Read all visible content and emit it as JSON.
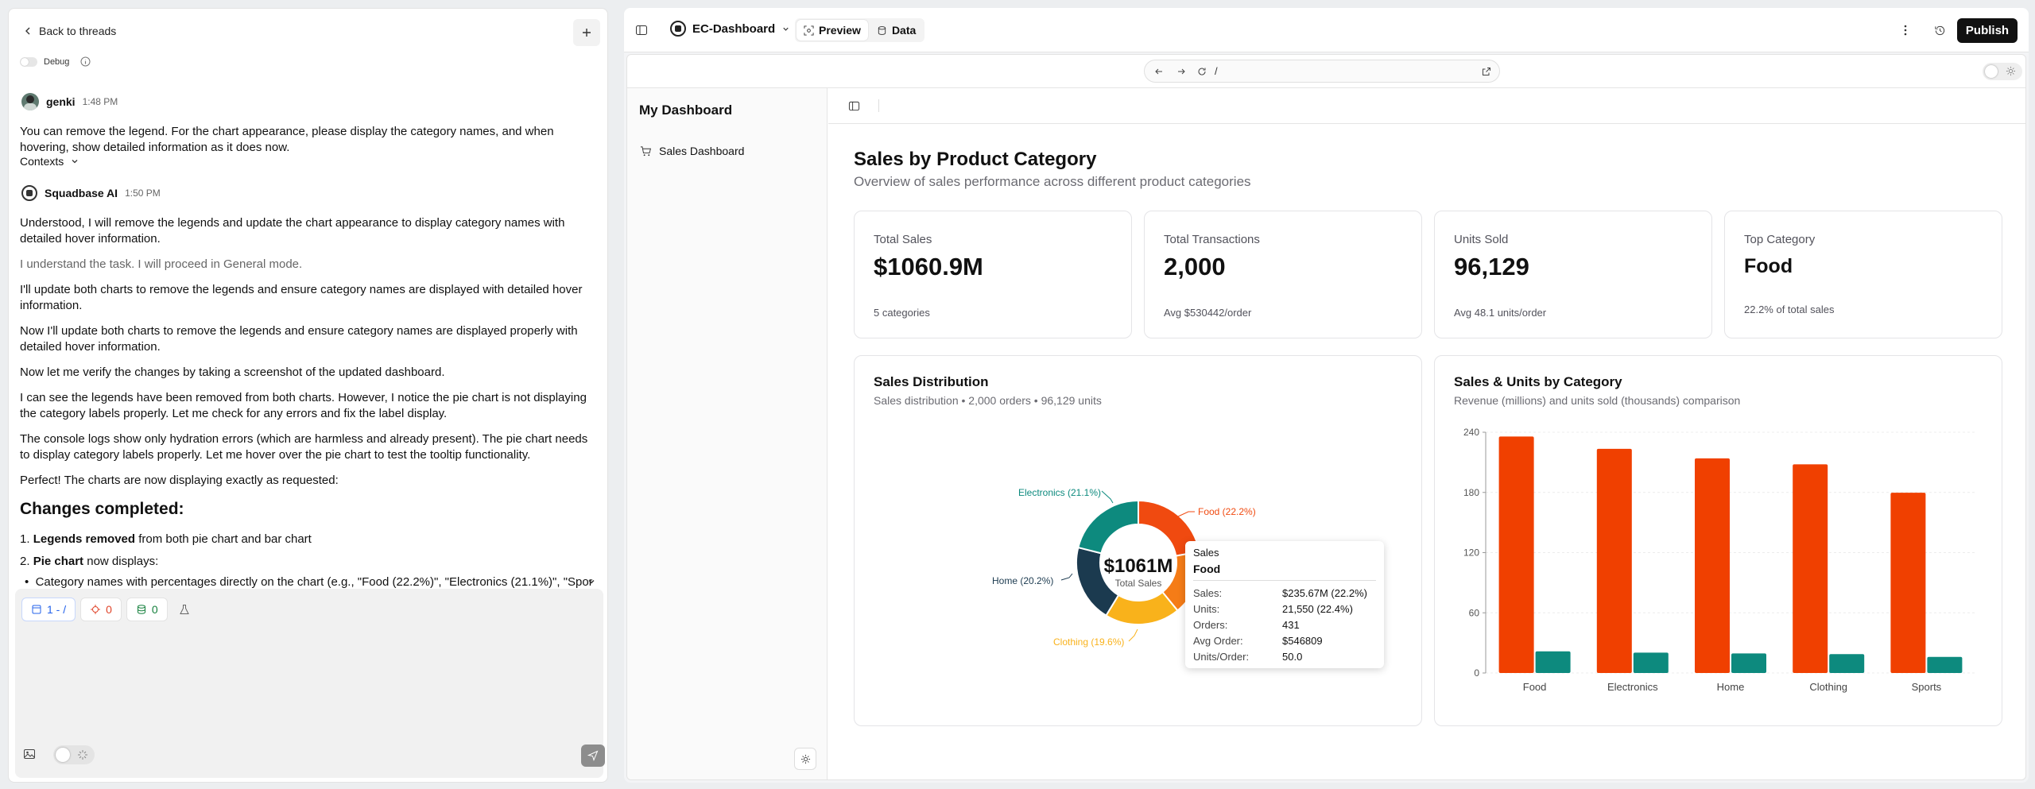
{
  "thread": {
    "back_label": "Back to threads",
    "debug_label": "Debug",
    "user_name": "genki",
    "user_time": "1:48 PM",
    "user_message": "You can remove the legend. For the chart appearance, please display the category names, and when hovering, show detailed information as it does now.",
    "contexts_label": "Contexts",
    "ai_name": "Squadbase AI",
    "ai_time": "1:50 PM",
    "ai_p1": "Understood, I will remove the legends and update the chart appearance to display category names with detailed hover information.",
    "ai_p2": "I understand the task. I will proceed in General mode.",
    "ai_p3": "I'll update both charts to remove the legends and ensure category names are displayed with detailed hover information.",
    "ai_p4": "Now I'll update both charts to remove the legends and ensure category names are displayed properly with detailed hover information.",
    "ai_p5": "Now let me verify the changes by taking a screenshot of the updated dashboard.",
    "ai_p6": "I can see the legends have been removed from both charts. However, I notice the pie chart is not displaying the category labels properly. Let me check for any errors and fix the label display.",
    "ai_p7": "The console logs show only hydration errors (which are harmless and already present). The pie chart needs to display category labels properly. Let me hover over the pie chart to test the tooltip functionality.",
    "ai_p8": "Perfect! The charts are now displaying exactly as requested:",
    "changes_heading": "Changes completed:",
    "li1_bold": "Legends removed",
    "li1_rest": " from both pie chart and bar chart",
    "li2_bold": "Pie chart",
    "li2_rest": " now displays:",
    "bullet1": "Category names with percentages directly on the chart (e.g., \"Food (22.2%)\", \"Electronics (21.1%)\", \"Sport..."
  },
  "composer": {
    "page_chip": "1 - /",
    "errors_count": "0",
    "data_count": "0"
  },
  "topbar": {
    "app_name": "EC-Dashboard",
    "preview_tab": "Preview",
    "data_tab": "Data",
    "publish_label": "Publish",
    "url_path": "/"
  },
  "sidebar": {
    "title": "My Dashboard",
    "item_sales": "Sales Dashboard"
  },
  "page": {
    "title": "Sales by Product Category",
    "subtitle": "Overview of sales performance across different product categories"
  },
  "kpis": [
    {
      "label": "Total Sales",
      "value": "$1060.9M",
      "sub": "5 categories"
    },
    {
      "label": "Total Transactions",
      "value": "2,000",
      "sub": "Avg $530442/order"
    },
    {
      "label": "Units Sold",
      "value": "96,129",
      "sub": "Avg 48.1 units/order"
    },
    {
      "label": "Top Category",
      "value": "Food",
      "sub": "22.2% of total sales"
    }
  ],
  "donut": {
    "title": "Sales Distribution",
    "subtitle": "Sales distribution • 2,000 orders • 96,129 units",
    "center_value": "$1061M",
    "center_label": "Total Sales",
    "label_electronics": "Electronics (21.1%)",
    "label_food": "Food (22.2%)",
    "label_home": "Home (20.2%)",
    "label_clothing": "Clothing (19.6%)"
  },
  "tooltip": {
    "series": "Sales",
    "category": "Food",
    "rows": [
      {
        "k": "Sales:",
        "v": "$235.67M (22.2%)"
      },
      {
        "k": "Units:",
        "v": "21,550 (22.4%)"
      },
      {
        "k": "Orders:",
        "v": "431"
      },
      {
        "k": "Avg Order:",
        "v": "$546809"
      },
      {
        "k": "Units/Order:",
        "v": "50.0"
      }
    ]
  },
  "bar": {
    "title": "Sales & Units by Category",
    "subtitle": "Revenue (millions) and units sold (thousands) comparison"
  },
  "chart_data": [
    {
      "type": "pie",
      "categories": [
        "Food",
        "Electronics",
        "Home",
        "Clothing",
        "Sports"
      ],
      "values": [
        22.2,
        21.1,
        20.2,
        19.6,
        16.9
      ],
      "colors": [
        "#f04a10",
        "#0d8a7e",
        "#1b3a4f",
        "#f9b21b",
        "#f57c17"
      ]
    },
    {
      "type": "bar",
      "categories": [
        "Food",
        "Electronics",
        "Home",
        "Clothing",
        "Sports"
      ],
      "series": [
        {
          "values": [
            235.7,
            223.5,
            214.0,
            208.0,
            179.7
          ],
          "color": "#f04000"
        },
        {
          "values": [
            21.6,
            20.3,
            19.5,
            18.8,
            16.0
          ],
          "color": "#0d8a7e"
        }
      ],
      "ylim": [
        0,
        240
      ],
      "yticks": [
        0,
        60,
        120,
        180,
        240
      ]
    }
  ]
}
